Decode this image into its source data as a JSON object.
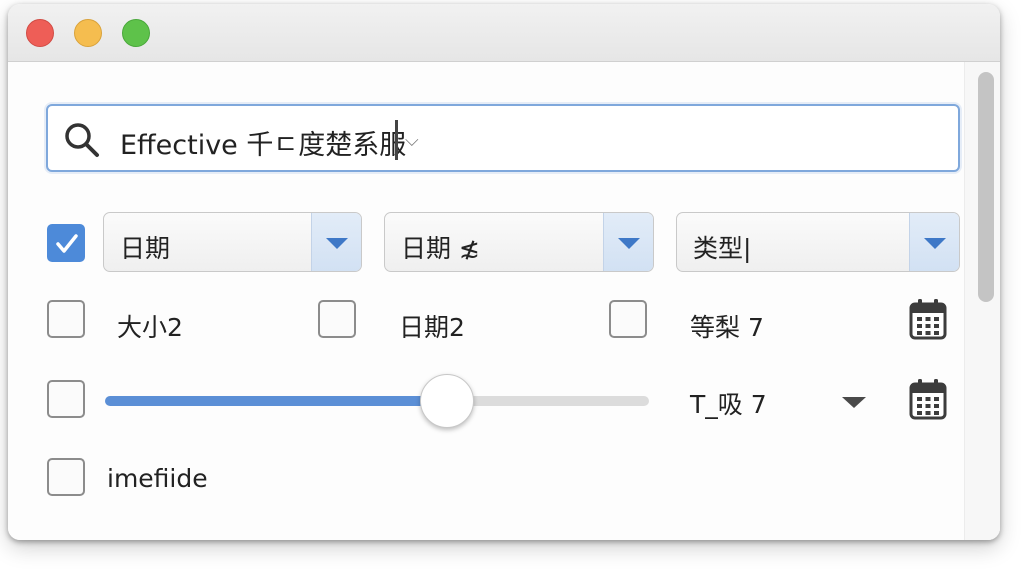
{
  "window": {
    "controls": [
      "close",
      "minimize",
      "zoom"
    ]
  },
  "search": {
    "icon": "search-icon",
    "value": "Effective 千ㄷ度楚系服",
    "dropdown_icon": "chevron-down-icon"
  },
  "filters": {
    "row1": {
      "checked": true,
      "select1": "日期",
      "select2": "日期 ≴",
      "select3": "类型|"
    },
    "row2": {
      "item1": {
        "checked": false,
        "label": "大小2"
      },
      "item2": {
        "checked": false,
        "label": "日期2"
      },
      "item3": {
        "checked": false,
        "label": "等梨 7"
      },
      "calendar_icon": "calendar-icon"
    },
    "row3": {
      "checked": false,
      "slider_value": 0.64,
      "label": "T_吸 7",
      "dropdown_icon": "triangle-down-icon",
      "calendar_icon": "calendar-icon"
    },
    "row4": {
      "checked": false,
      "label": "imefiide"
    }
  },
  "colors": {
    "accent": "#4d8ad9",
    "focus_border": "#7fa8dc",
    "close": "#ee5e57",
    "minimize": "#f5bd4f",
    "zoom": "#5ec24a"
  }
}
